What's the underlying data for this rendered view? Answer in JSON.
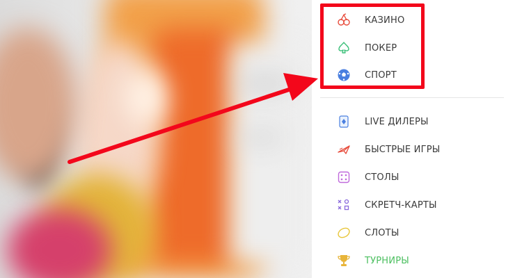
{
  "primary_menu": [
    {
      "label": "КАЗИНО",
      "icon": "cherries-icon"
    },
    {
      "label": "ПОКЕР",
      "icon": "spade-icon"
    },
    {
      "label": "СПОРТ",
      "icon": "soccer-ball-icon"
    }
  ],
  "secondary_menu": [
    {
      "label": "LIVE ДИЛЕРЫ",
      "icon": "playing-card-icon"
    },
    {
      "label": "БЫСТРЫЕ ИГРЫ",
      "icon": "paper-plane-icon"
    },
    {
      "label": "СТОЛЫ",
      "icon": "dice-icon"
    },
    {
      "label": "СКРЕТЧ-КАРТЫ",
      "icon": "scratch-card-icon"
    },
    {
      "label": "СЛОТЫ",
      "icon": "slot-oval-icon"
    },
    {
      "label": "ТУРНИРЫ",
      "icon": "trophy-icon",
      "color": "#4bbf5f"
    }
  ],
  "colors": {
    "highlight": "#f3071b",
    "arrow": "#f3071b",
    "text": "#3a3a3a",
    "tournaments_text": "#4bbf5f"
  }
}
